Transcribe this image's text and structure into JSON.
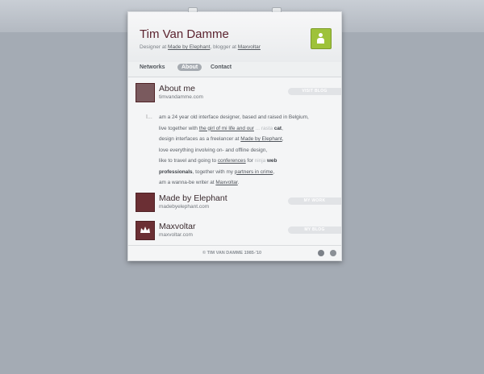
{
  "header": {
    "name": "Tim Van Damme",
    "sub_prefix": "Designer at ",
    "sub_link1": "Made by Elephant",
    "sub_mid": ", blogger at ",
    "sub_link2": "Maxvoltar"
  },
  "nav": {
    "items": [
      "Networks",
      "About",
      "Contact"
    ],
    "active": "About"
  },
  "about": {
    "title": "About me",
    "url": "timvandamme.com",
    "button": "VISIT BLOG"
  },
  "bio": {
    "quote_mark": "I...",
    "line1": "am a 24 year old interface designer, based and raised in Belgium,",
    "line2_prefix": "live together with ",
    "line2_link": "the girl of mi life and our",
    "line2_faint": " ... rasta ",
    "line2_cat": "cat",
    "line2_end": ",",
    "line3_prefix": "design interfaces as a freelancer at ",
    "line3_link": "Made by Elephant",
    "line3_end": ",",
    "line4": "love everything involving on- and offline design,",
    "line5_prefix": "like to travel and going to ",
    "line5_link": "conferences",
    "line5_mid": " for ",
    "line5_faint": "ninja",
    "line5_bold": " web",
    "line6_bold": "professionals",
    "line6_mid": ", together with my ",
    "line6_link": "partners in crime",
    "line6_end": ",",
    "line7_prefix": "am a wanna-be writer at ",
    "line7_link": "Maxvoltar",
    "line7_end": "."
  },
  "items": [
    {
      "title": "Made by Elephant",
      "url": "madebyelephant.com",
      "button": "MY WORK"
    },
    {
      "title": "Maxvoltar",
      "url": "maxvoltar.com",
      "button": "MY BLOG"
    }
  ],
  "footer": {
    "copyright": "© TIM VAN DAMME 1985-'10"
  },
  "colors": {
    "background": "#a4abb4",
    "accent": "#5c2430",
    "avatar": "#9ec23a",
    "icon": "#6b2f34"
  }
}
